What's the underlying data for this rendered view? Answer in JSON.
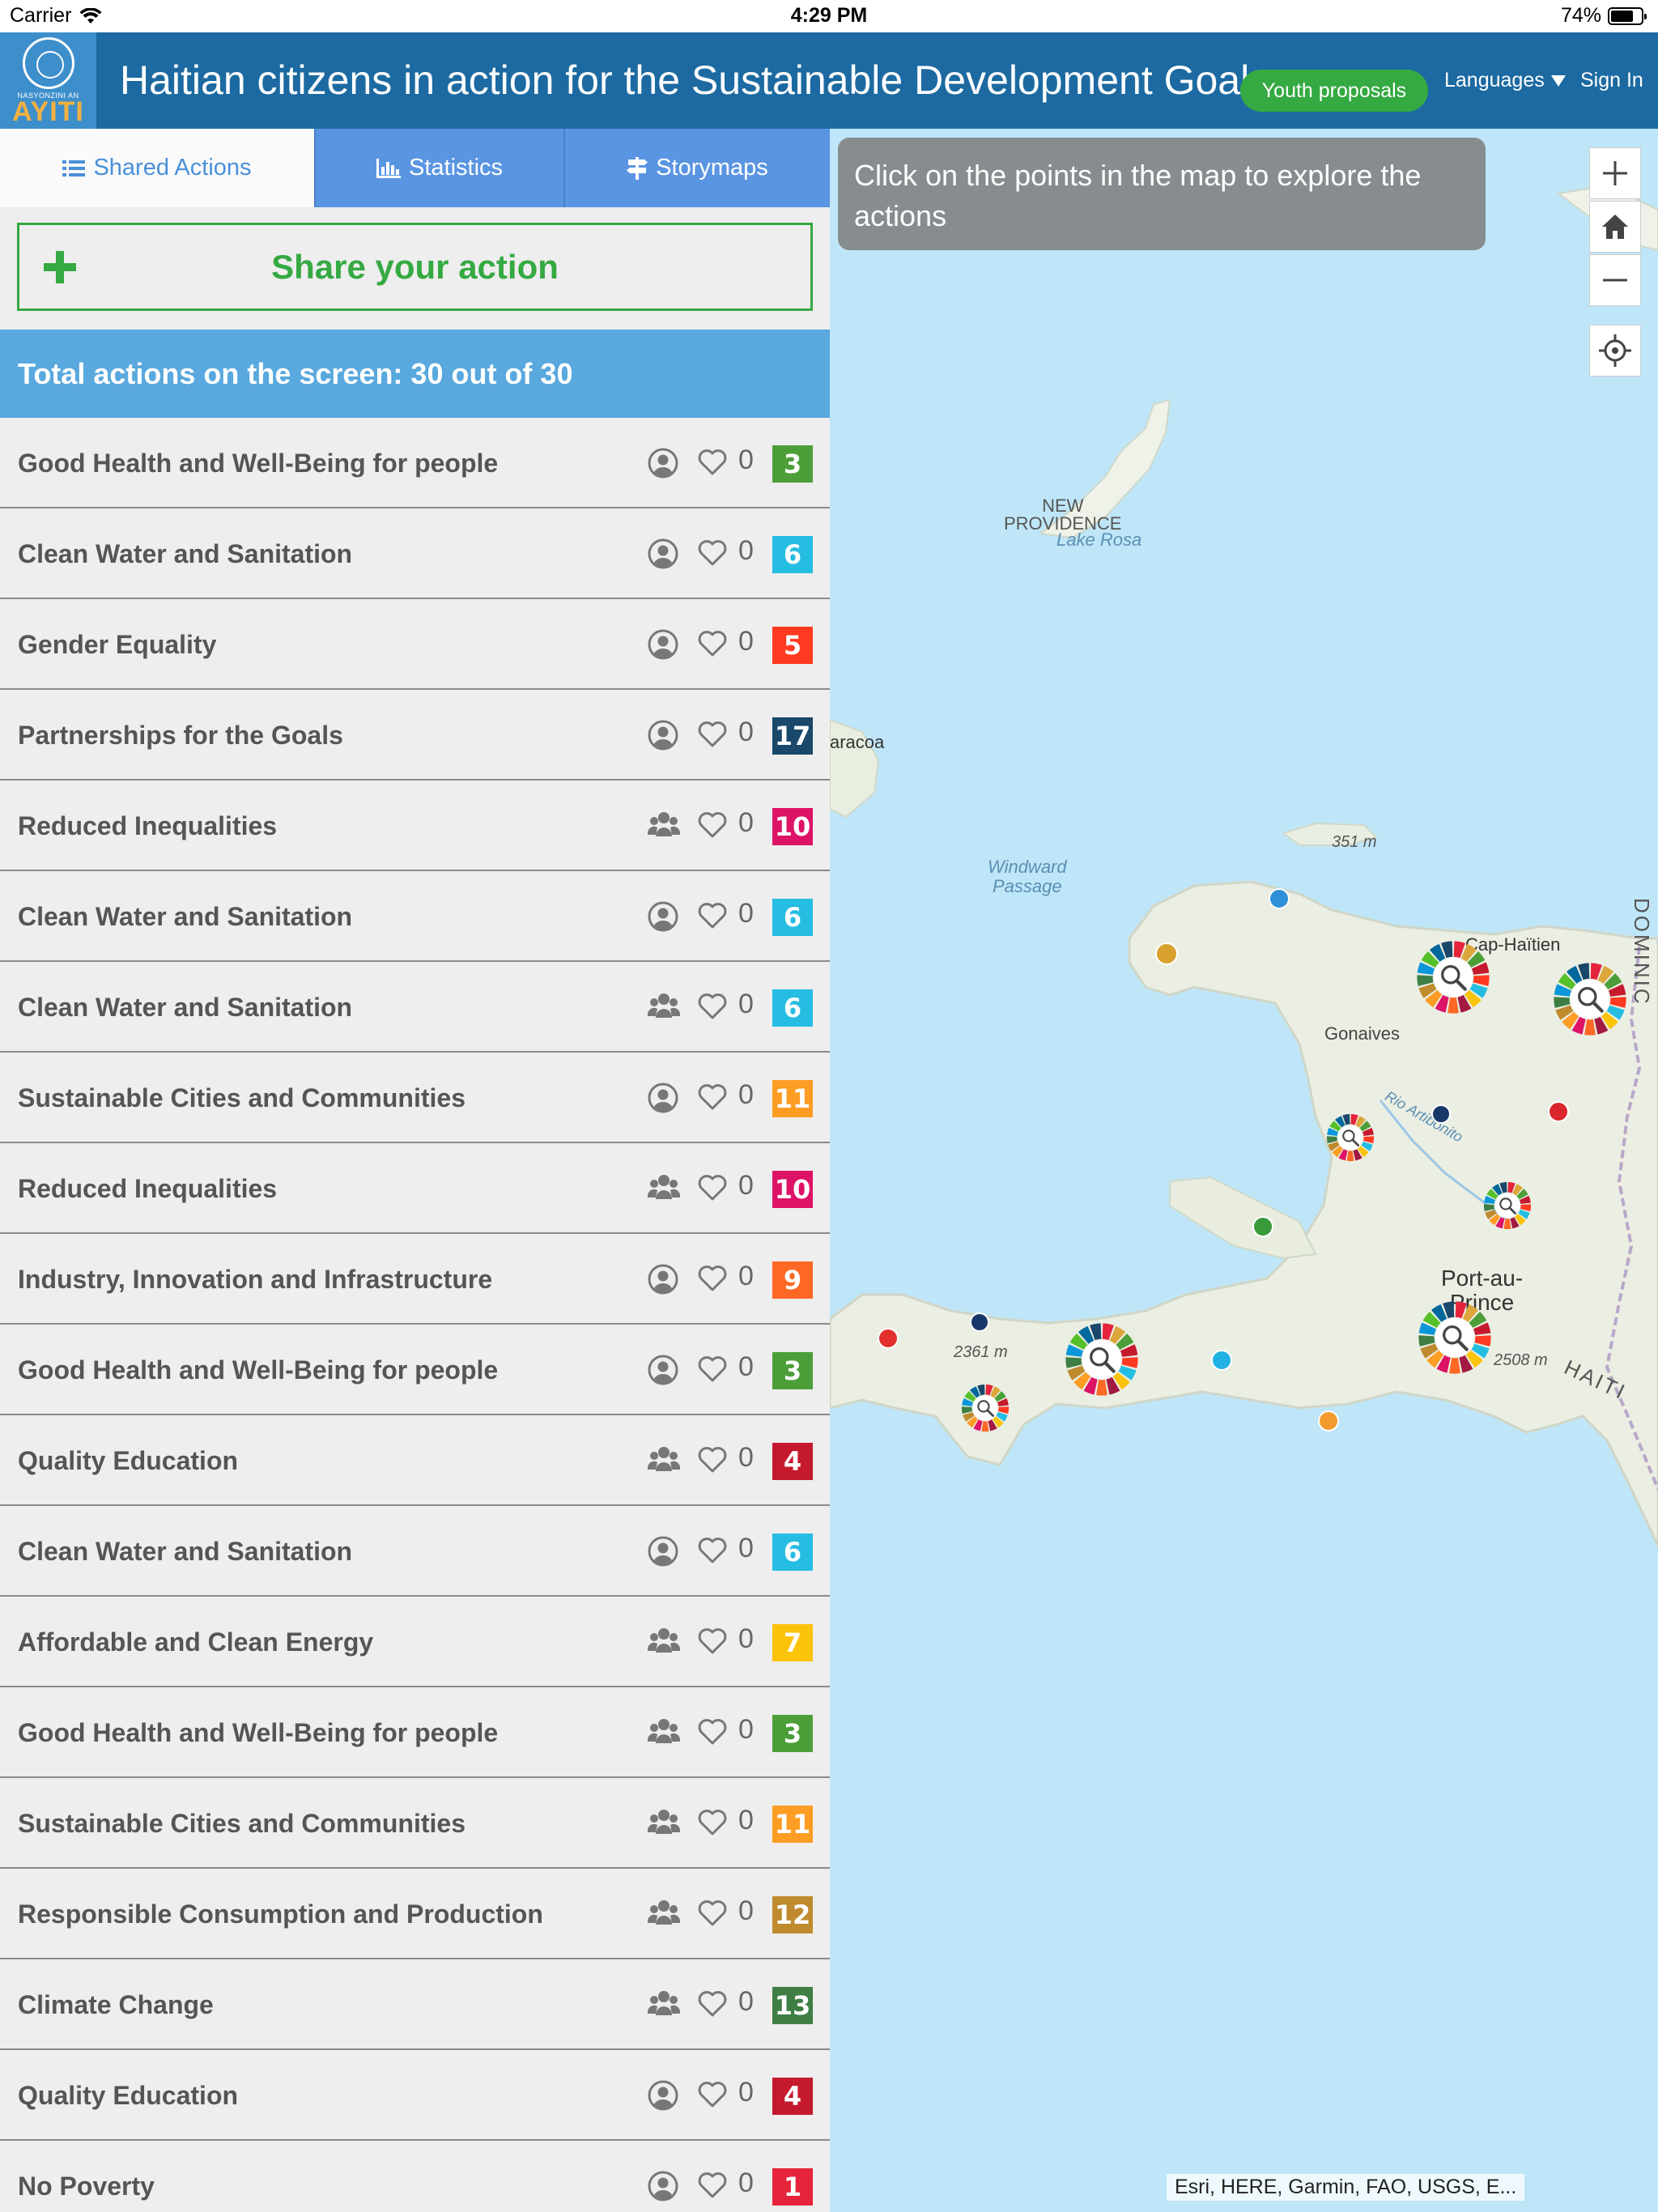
{
  "status_bar": {
    "carrier": "Carrier",
    "time": "4:29 PM",
    "battery": "74%",
    "battery_level": 0.74
  },
  "header": {
    "logo_line1": "NASYONZINI AN",
    "logo_line2": "AYITI",
    "title": "Haitian citizens in action for the Sustainable Development Goals",
    "youth_button": "Youth proposals",
    "languages": "Languages",
    "sign_in": "Sign In"
  },
  "tabs": [
    {
      "label": "Shared Actions",
      "icon": "list-icon",
      "active": true
    },
    {
      "label": "Statistics",
      "icon": "bar-chart-icon",
      "active": false
    },
    {
      "label": "Storymaps",
      "icon": "signpost-icon",
      "active": false
    }
  ],
  "share_button": "Share your action",
  "total_text": "Total actions on the screen: 30 out of 30",
  "actions": [
    {
      "name": "Good Health and Well-Being for people",
      "type": "individual",
      "likes": "0",
      "sdg": "3",
      "color": "#4c9f38"
    },
    {
      "name": "Clean Water and Sanitation",
      "type": "individual",
      "likes": "0",
      "sdg": "6",
      "color": "#26bde2"
    },
    {
      "name": "Gender Equality",
      "type": "individual",
      "likes": "0",
      "sdg": "5",
      "color": "#ff3a21"
    },
    {
      "name": "Partnerships for the Goals",
      "type": "individual",
      "likes": "0",
      "sdg": "17",
      "color": "#19486a"
    },
    {
      "name": "Reduced Inequalities",
      "type": "group",
      "likes": "0",
      "sdg": "10",
      "color": "#dd1367"
    },
    {
      "name": "Clean Water and Sanitation",
      "type": "individual",
      "likes": "0",
      "sdg": "6",
      "color": "#26bde2"
    },
    {
      "name": "Clean Water and Sanitation",
      "type": "group",
      "likes": "0",
      "sdg": "6",
      "color": "#26bde2"
    },
    {
      "name": "Sustainable Cities and Communities",
      "type": "individual",
      "likes": "0",
      "sdg": "11",
      "color": "#fd9d24"
    },
    {
      "name": "Reduced Inequalities",
      "type": "group",
      "likes": "0",
      "sdg": "10",
      "color": "#dd1367"
    },
    {
      "name": "Industry, Innovation and Infrastructure",
      "type": "individual",
      "likes": "0",
      "sdg": "9",
      "color": "#fd6925"
    },
    {
      "name": "Good Health and Well-Being for people",
      "type": "individual",
      "likes": "0",
      "sdg": "3",
      "color": "#4c9f38"
    },
    {
      "name": "Quality Education",
      "type": "group",
      "likes": "0",
      "sdg": "4",
      "color": "#c5192d"
    },
    {
      "name": "Clean Water and Sanitation",
      "type": "individual",
      "likes": "0",
      "sdg": "6",
      "color": "#26bde2"
    },
    {
      "name": "Affordable and Clean Energy",
      "type": "group",
      "likes": "0",
      "sdg": "7",
      "color": "#fcc30b"
    },
    {
      "name": "Good Health and Well-Being for people",
      "type": "group",
      "likes": "0",
      "sdg": "3",
      "color": "#4c9f38"
    },
    {
      "name": "Sustainable Cities and Communities",
      "type": "group",
      "likes": "0",
      "sdg": "11",
      "color": "#fd9d24"
    },
    {
      "name": "Responsible Consumption and Production",
      "type": "group",
      "likes": "0",
      "sdg": "12",
      "color": "#bf8b2e"
    },
    {
      "name": "Climate Change",
      "type": "group",
      "likes": "0",
      "sdg": "13",
      "color": "#3f7e44"
    },
    {
      "name": "Quality Education",
      "type": "individual",
      "likes": "0",
      "sdg": "4",
      "color": "#c5192d"
    },
    {
      "name": "No Poverty",
      "type": "individual",
      "likes": "0",
      "sdg": "1",
      "color": "#e5243b"
    }
  ],
  "map": {
    "info": "Click on the points in the map to explore the actions",
    "controls": [
      "zoom-in-icon",
      "home-icon",
      "zoom-out-icon",
      "locate-icon"
    ],
    "attribution": "Esri, HERE, Garmin, FAO, USGS, E...",
    "labels": {
      "new_providence": "NEW\nPROVIDENCE",
      "lake_rosa": "Lake Rosa",
      "baracoa": "aracoa",
      "windward": "Windward\nPassage",
      "elev1": "351 m",
      "cap_haitien": "Cap-Haïtien",
      "gonaives": "Gonaives",
      "rio": "Rio Artibonito",
      "port_au_prince": "Port-au-\nPrince",
      "elev2": "2361 m",
      "elev3": "2508 m",
      "haiti": "HAITI",
      "dominicana": "DOMINIC"
    }
  }
}
